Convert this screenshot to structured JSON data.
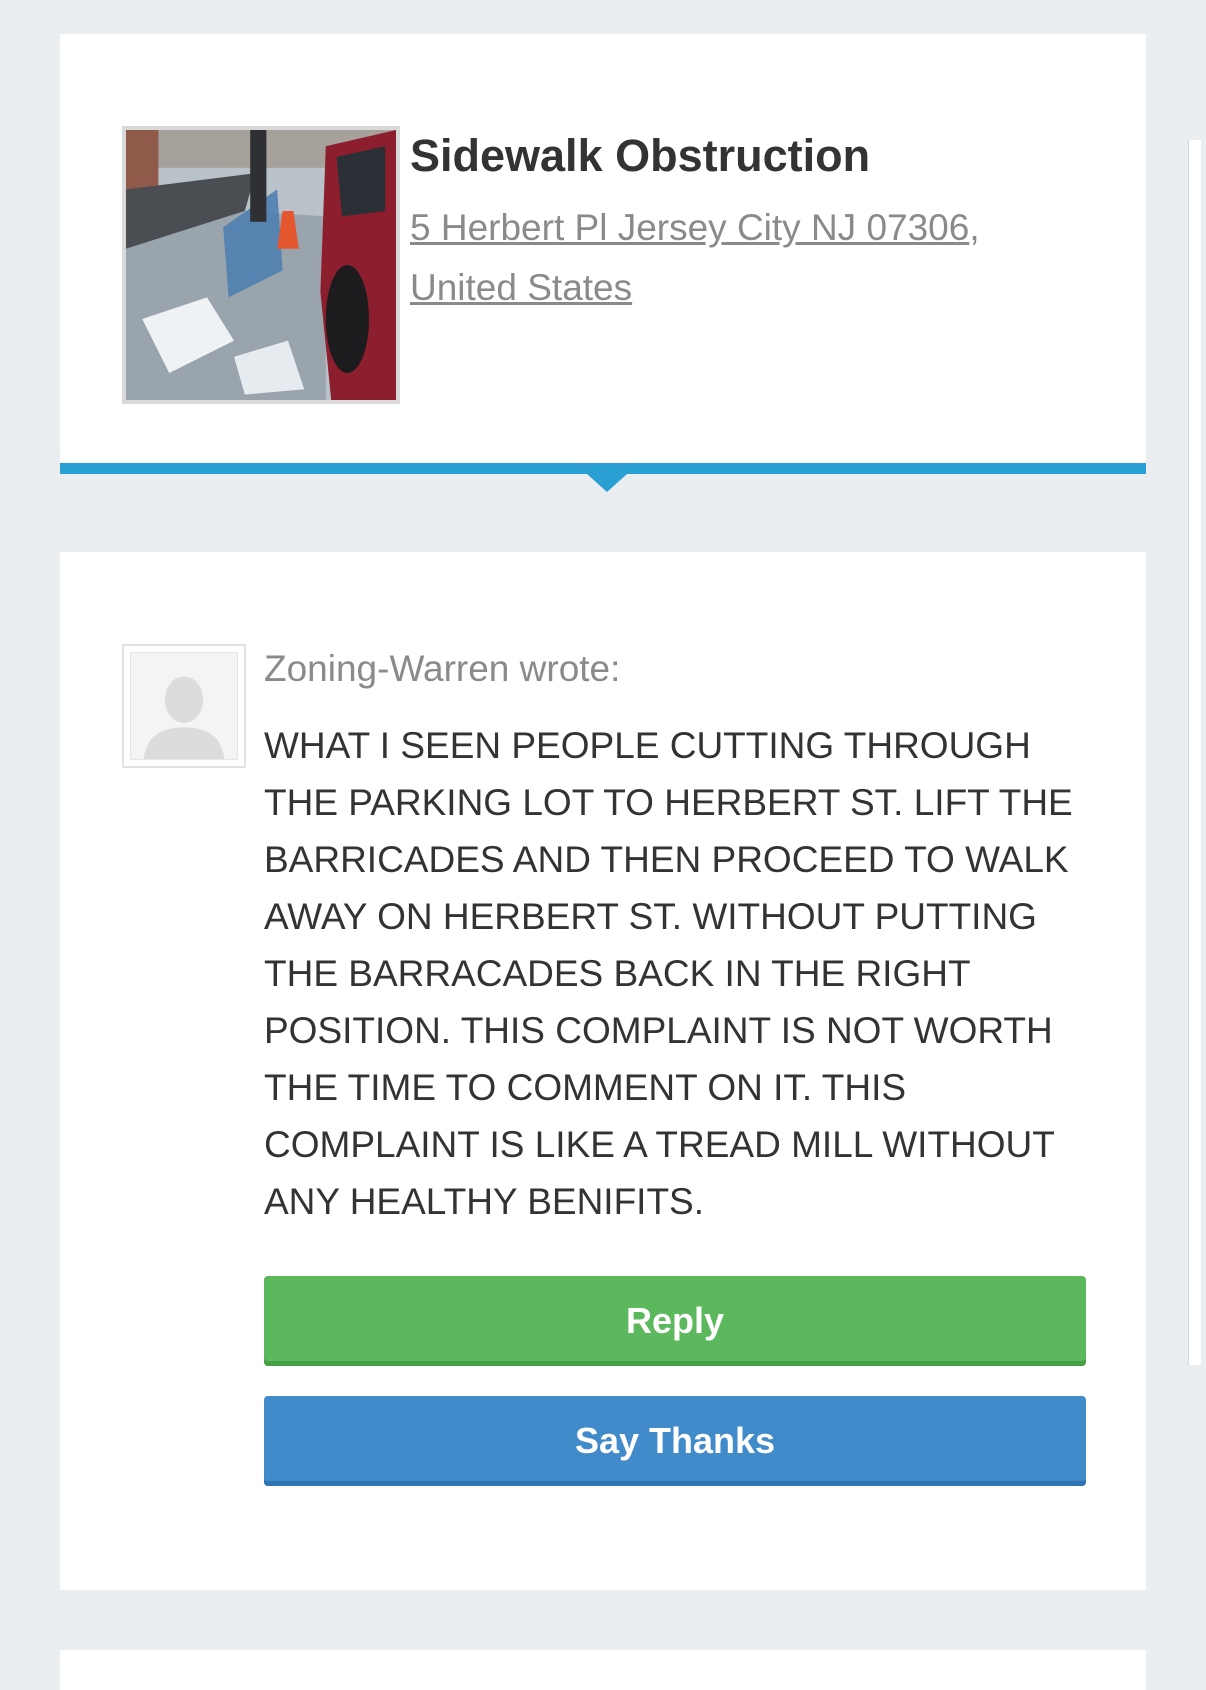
{
  "issue": {
    "title": "Sidewalk Obstruction",
    "address_line1": "5 Herbert Pl Jersey City NJ 07306",
    "address_sep": ",",
    "address_line2": "United States",
    "accent_color": "#2a9fd3",
    "photo_icon": "issue-photo"
  },
  "comment": {
    "author_line": "Zoning-Warren wrote:",
    "avatar_icon": "default-user-avatar",
    "body": "WHAT I SEEN PEOPLE CUTTING THROUGH THE PARKING LOT TO HERBERT ST. LIFT THE BARRICADES AND THEN PROCEED TO WALK AWAY ON HERBERT ST. WITHOUT PUTTING THE BARRACADES BACK IN THE RIGHT POSITION. THIS COMPLAINT IS NOT WORTH THE TIME TO COMMENT ON IT. THIS COMPLAINT IS LIKE A TREAD MILL WITHOUT ANY HEALTHY BENIFITS."
  },
  "actions": {
    "reply_label": "Reply",
    "reply_color": "#5cb85c",
    "thanks_label": "Say Thanks",
    "thanks_color": "#428bca"
  }
}
